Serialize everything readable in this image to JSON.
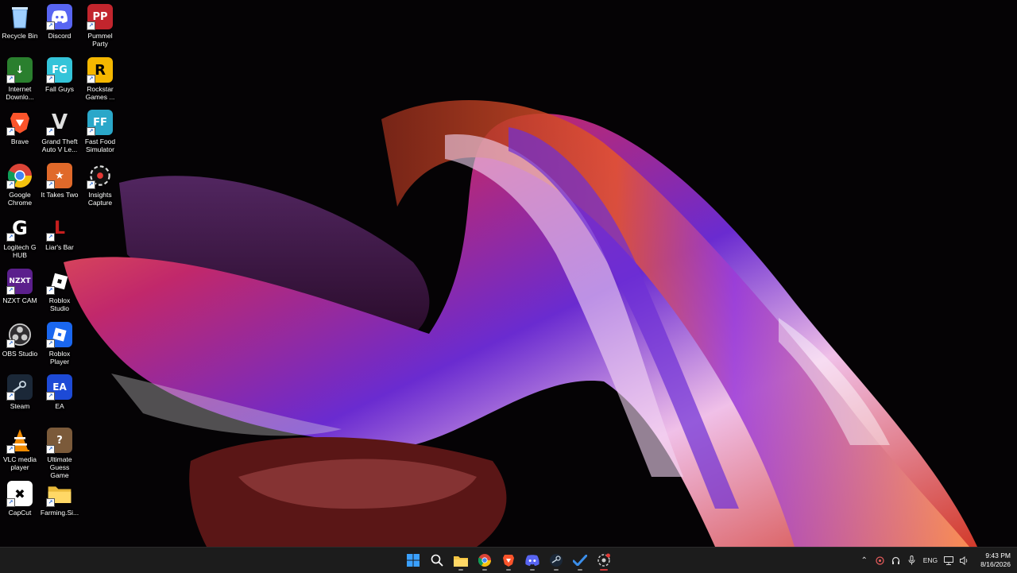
{
  "desktop_icons": [
    {
      "label": "Recycle Bin",
      "icon": "recycle-bin-icon"
    },
    {
      "label": "Discord",
      "icon": "discord-icon"
    },
    {
      "label": "Pummel Party",
      "icon": "pummel-party-icon"
    },
    {
      "label": "Internet Downlo...",
      "icon": "internet-download-manager-icon"
    },
    {
      "label": "Fall Guys",
      "icon": "fall-guys-icon"
    },
    {
      "label": "Rockstar Games ...",
      "icon": "rockstar-games-icon"
    },
    {
      "label": "Brave",
      "icon": "brave-icon"
    },
    {
      "label": "Grand Theft Auto V Le...",
      "icon": "gta-v-icon"
    },
    {
      "label": "Fast Food Simulator",
      "icon": "fast-food-simulator-icon"
    },
    {
      "label": "Google Chrome",
      "icon": "chrome-icon"
    },
    {
      "label": "It Takes Two",
      "icon": "it-takes-two-icon"
    },
    {
      "label": "Insights Capture",
      "icon": "insights-capture-icon"
    },
    {
      "label": "Logitech G HUB",
      "icon": "logitech-g-hub-icon"
    },
    {
      "label": "Liar's Bar",
      "icon": "liars-bar-icon"
    },
    {
      "label": "NZXT CAM",
      "icon": "nzxt-cam-icon"
    },
    {
      "label": "Roblox Studio",
      "icon": "roblox-studio-icon"
    },
    {
      "label": "OBS Studio",
      "icon": "obs-studio-icon"
    },
    {
      "label": "Roblox Player",
      "icon": "roblox-player-icon"
    },
    {
      "label": "Steam",
      "icon": "steam-icon"
    },
    {
      "label": "EA",
      "icon": "ea-icon"
    },
    {
      "label": "VLC media player",
      "icon": "vlc-icon"
    },
    {
      "label": "Ultimate Guess Game",
      "icon": "ultimate-guess-game-icon"
    },
    {
      "label": "CapCut",
      "icon": "capcut-icon"
    },
    {
      "label": "Farming.Si...",
      "icon": "folder-icon"
    }
  ],
  "taskbar": {
    "pinned": [
      {
        "name": "start",
        "icon": "windows-start-icon"
      },
      {
        "name": "search",
        "icon": "search-icon"
      },
      {
        "name": "file-explorer",
        "icon": "folder-icon"
      },
      {
        "name": "chrome",
        "icon": "chrome-icon"
      },
      {
        "name": "brave",
        "icon": "brave-icon"
      },
      {
        "name": "discord",
        "icon": "discord-icon"
      },
      {
        "name": "steam",
        "icon": "steam-icon"
      },
      {
        "name": "todo",
        "icon": "checkmark-icon"
      },
      {
        "name": "insights-capture",
        "icon": "insights-capture-icon"
      }
    ],
    "tray": {
      "language": "ENG",
      "time": "9:43 PM",
      "date": "8/16/2026"
    }
  },
  "colors": {
    "taskbar_bg": "#1c1c1c",
    "wallpaper_bg": "#050305",
    "accent": "#0078d4"
  }
}
